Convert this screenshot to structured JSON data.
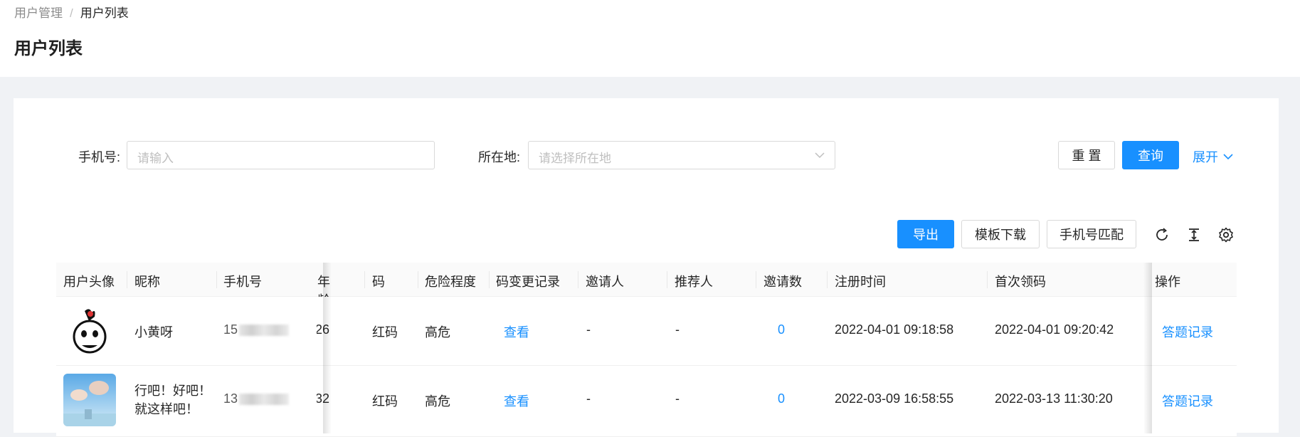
{
  "breadcrumb": {
    "parent": "用户管理",
    "separator": "/",
    "current": "用户列表"
  },
  "page_title": "用户列表",
  "search": {
    "phone_label": "手机号:",
    "phone_placeholder": "请输入",
    "location_label": "所在地:",
    "location_placeholder": "请选择所在地",
    "reset_label": "重 置",
    "query_label": "查询",
    "expand_label": "展开"
  },
  "toolbar": {
    "export_label": "导出",
    "template_label": "模板下载",
    "match_label": "手机号匹配",
    "icons": [
      "reload-icon",
      "column-height-icon",
      "setting-icon"
    ]
  },
  "table": {
    "columns": [
      "用户头像",
      "昵称",
      "手机号",
      "年龄",
      "码",
      "危险程度",
      "码变更记录",
      "邀请人",
      "推荐人",
      "邀请数",
      "注册时间",
      "首次领码",
      "操作"
    ],
    "rows": [
      {
        "avatar": "cartoon-face-avatar",
        "nickname_line1": "小黄呀",
        "nickname_line2": "",
        "phone_prefix": "15",
        "age": "26",
        "code": "红码",
        "danger": "高危",
        "code_history": "查看",
        "inviter": "-",
        "referrer": "-",
        "invite_count": "0",
        "register_time": "2022-04-01 09:18:58",
        "first_code_time": "2022-04-01 09:20:42",
        "action": "答题记录"
      },
      {
        "avatar": "photo-avatar",
        "nickname_line1": "行吧！好吧！",
        "nickname_line2": "就这样吧！",
        "phone_prefix": "13",
        "age": "32",
        "code": "红码",
        "danger": "高危",
        "code_history": "查看",
        "inviter": "-",
        "referrer": "-",
        "invite_count": "0",
        "register_time": "2022-03-09 16:58:55",
        "first_code_time": "2022-03-13 11:30:20",
        "action": "答题记录"
      }
    ]
  },
  "colors": {
    "primary": "#1890ff",
    "border": "#d9d9d9",
    "page_bg": "#f0f2f5"
  }
}
